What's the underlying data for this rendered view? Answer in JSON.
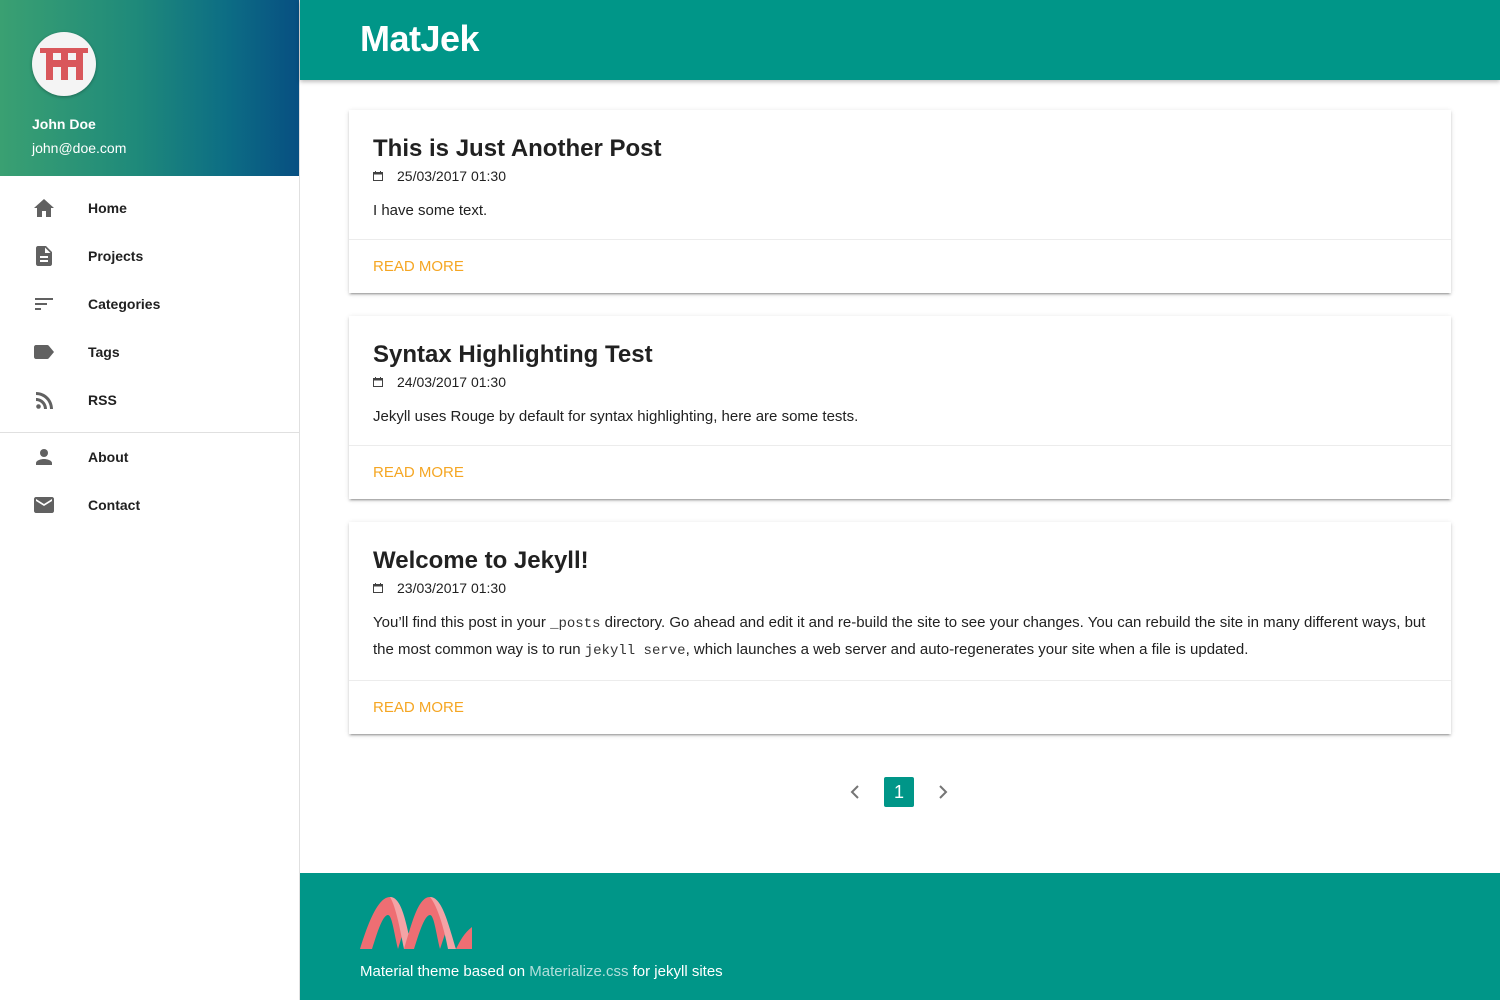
{
  "profile": {
    "name": "John Doe",
    "email": "john@doe.com",
    "avatar_icon": "avatar-logo-icon"
  },
  "sidebar": {
    "items": [
      {
        "label": "Home",
        "icon": "home-icon"
      },
      {
        "label": "Projects",
        "icon": "document-icon"
      },
      {
        "label": "Categories",
        "icon": "sort-icon"
      },
      {
        "label": "Tags",
        "icon": "tag-icon"
      },
      {
        "label": "RSS",
        "icon": "rss-icon"
      }
    ],
    "secondary": [
      {
        "label": "About",
        "icon": "person-icon"
      },
      {
        "label": "Contact",
        "icon": "mail-icon"
      }
    ]
  },
  "header": {
    "title": "MatJek"
  },
  "posts": [
    {
      "title": "This is Just Another Post",
      "date": "25/03/2017 01:30",
      "excerpt": "I have some text.",
      "action": "READ MORE"
    },
    {
      "title": "Syntax Highlighting Test",
      "date": "24/03/2017 01:30",
      "excerpt": "Jekyll uses Rouge by default for syntax highlighting, here are some tests.",
      "action": "READ MORE"
    },
    {
      "title": "Welcome to Jekyll!",
      "date": "23/03/2017 01:30",
      "excerpt_parts": {
        "p1": "You’ll find this post in your ",
        "code1": "_posts",
        "p2": " directory. Go ahead and edit it and re-build the site to see your changes. You can rebuild the site in many different ways, but the most common way is to run ",
        "code2": "jekyll serve",
        "p3": ", which launches a web server and auto-regenerates your site when a file is updated."
      },
      "action": "READ MORE"
    }
  ],
  "pagination": {
    "current": "1"
  },
  "footer": {
    "text_before": "Material theme based on ",
    "link": "Materialize.css",
    "text_after": " for jekyll sites"
  },
  "colors": {
    "primary": "#009688",
    "accent": "#f5a623",
    "logo": "#e57373"
  }
}
